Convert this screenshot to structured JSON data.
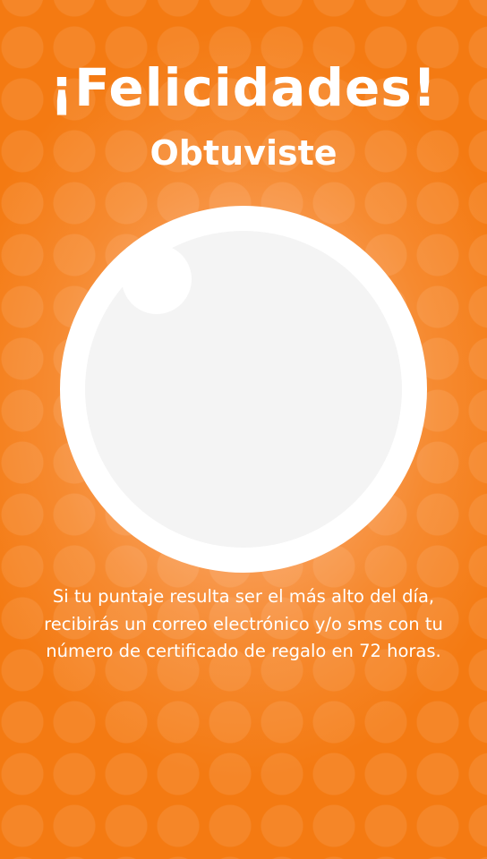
{
  "screen": {
    "title": "¡Felicidades!",
    "subtitle": "Obtuviste",
    "message_lines": [
      "Si tu puntaje resulta ser el más alto del día,",
      "recibirás un correo electrónico y/o sms con tu",
      "número de certificado de regalo en 72 horas."
    ]
  },
  "colors": {
    "background": "#f47a12",
    "glow": "#fbb37a",
    "text": "#ffffff",
    "circle_ring": "#ffffff",
    "circle_fill": "#f4f4f4"
  },
  "icons": {
    "prize": "prize-circle-placeholder"
  }
}
